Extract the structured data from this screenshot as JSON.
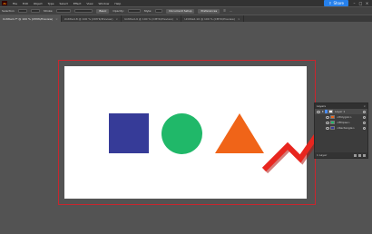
{
  "app": {
    "logo_text": "Ai",
    "share_label": "Share"
  },
  "menu": [
    "File",
    "Edit",
    "Object",
    "Type",
    "Select",
    "Effect",
    "View",
    "Window",
    "Help"
  ],
  "control_bar": {
    "selection_label": "Selection",
    "stroke_label": "Stroke:",
    "style_label": "Basic",
    "opacity_label": "Opacity:",
    "style_name": "Style:",
    "doc_setup": "Document Setup",
    "preferences": "Preferences"
  },
  "tabs": [
    {
      "label": "Untitled-7* @ 100 % (CMYK/Preview)",
      "active": true
    },
    {
      "label": "Untitled-8 @ 100 % (CMYK/Preview)",
      "active": false
    },
    {
      "label": "Untitled-9 @ 100 % (CMYK/Preview)",
      "active": false
    },
    {
      "label": "Untitled-10 @ 100 % (CMYK/Preview)",
      "active": false
    }
  ],
  "artboard": {
    "shapes": [
      {
        "name": "square",
        "color": "#363b98"
      },
      {
        "name": "circle",
        "color": "#20b869"
      },
      {
        "name": "triangle",
        "color": "#f06418"
      }
    ]
  },
  "arrow": {
    "color": "#e8261f"
  },
  "layers_panel": {
    "title": "Layers",
    "close": "×",
    "layers": [
      {
        "name": "Layer 1",
        "level": 0
      },
      {
        "name": "<Polygon>",
        "level": 1
      },
      {
        "name": "<Ellipse>",
        "level": 1
      },
      {
        "name": "<Rectangle>",
        "level": 1
      }
    ],
    "footer_label": "1 Layer"
  }
}
